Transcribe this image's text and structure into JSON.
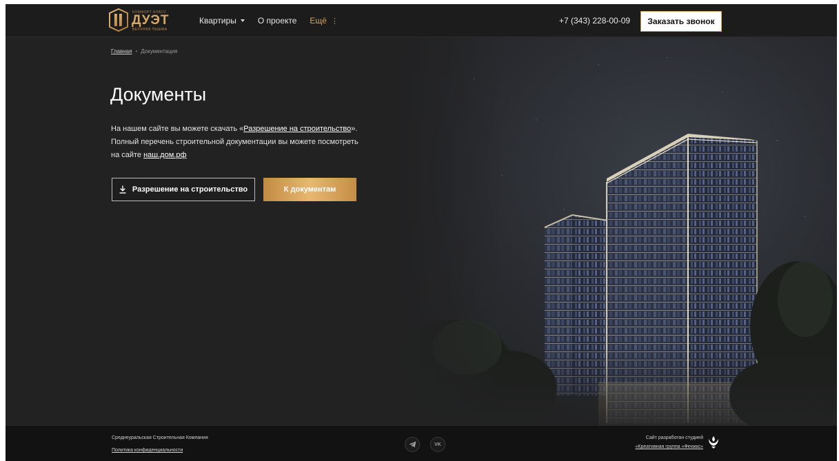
{
  "header": {
    "logo": {
      "top": "КОМФОРТ-КЛАСС",
      "main": "ДУЭТ",
      "sub": "ВЕРХНЯЯ ПЫШМА"
    },
    "nav": [
      {
        "label": "Квартиры",
        "has_dropdown": true
      },
      {
        "label": "О проекте"
      },
      {
        "label": "Ещё",
        "accent": true
      }
    ],
    "phone": "+7 (343) 228-00-09",
    "callback_label": "Заказать звонок"
  },
  "breadcrumb": {
    "home": "Главная",
    "sep": "•",
    "current": "Документация"
  },
  "main": {
    "title": "Документы",
    "desc": {
      "line1_pre": "На нашем сайте вы можете скачать «",
      "line1_link": "Разрешение на строительство",
      "line1_post": "».",
      "line2": "Полный перечень строительной документации вы можете посмотреть",
      "line3_pre": "на сайте ",
      "line3_link": "наш.дом.рф"
    },
    "permit_button": "Разрешение на строительство",
    "docs_button": "К документам"
  },
  "footer": {
    "company": "Среднеуральская Строительная Компания",
    "privacy": "Политика конфиденциальности",
    "social": {
      "vk": "VK"
    },
    "studio_text": "Сайт разработан студией",
    "studio_link": "«Креативная группа «Феникс»"
  },
  "colors": {
    "accent": "#d4a35c",
    "background": "#222223",
    "footer": "#121213",
    "header": "#1c1c1d"
  }
}
